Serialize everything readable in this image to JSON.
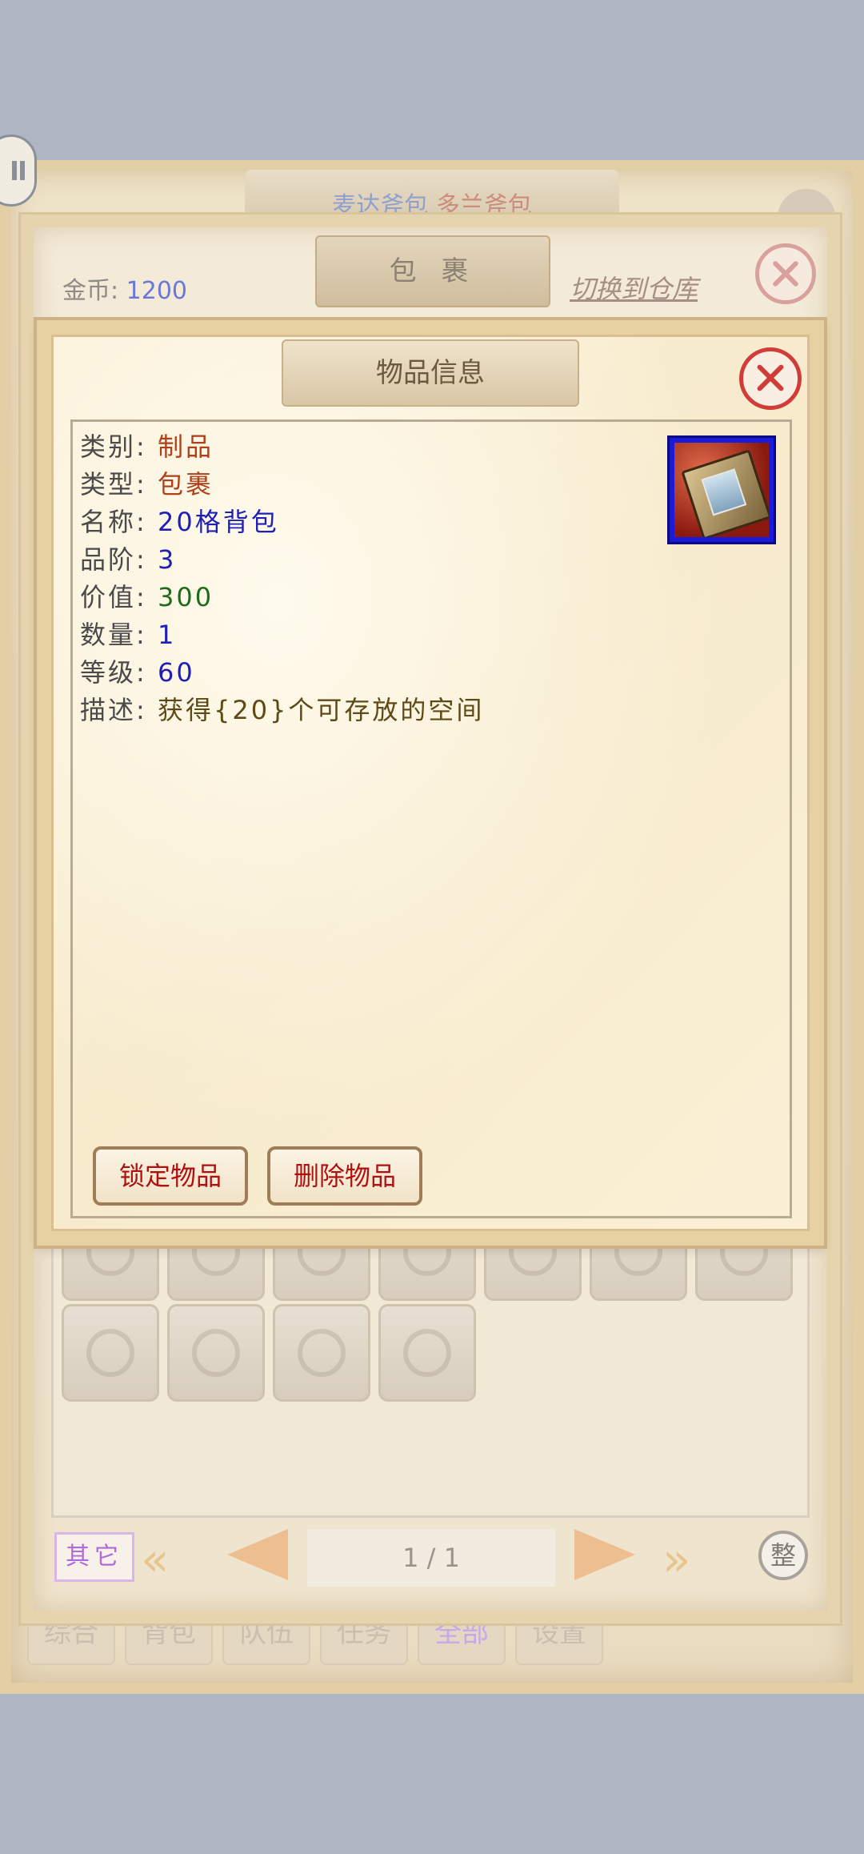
{
  "background_menu": {
    "top_tab_text_a": "麦达斧包",
    "top_tab_text_b": "多兰斧包",
    "bottom_tabs": [
      "综合",
      "背包",
      "队伍",
      "任务",
      "全部",
      "设置"
    ],
    "active_tab": "全部"
  },
  "bag": {
    "title": "包 裹",
    "gold_label": "金币:",
    "gold_value": "1200",
    "switch_link": "切换到仓库",
    "other_button": "其它",
    "page_indicator": "1 / 1",
    "sort_button": "整"
  },
  "item_dialog": {
    "title": "物品信息",
    "rows": [
      {
        "label": "类别:",
        "value": "制品",
        "color": "#b0401a"
      },
      {
        "label": "类型:",
        "value": "包裹",
        "color": "#b0401a"
      },
      {
        "label": "名称:",
        "value": "20格背包",
        "color": "#1f1fb5"
      },
      {
        "label": "品阶:",
        "value": "3",
        "color": "#1f1fb5"
      },
      {
        "label": "价值:",
        "value": "300",
        "color": "#1e6b1a"
      },
      {
        "label": "数量:",
        "value": "1",
        "color": "#1f1fb5"
      },
      {
        "label": "等级:",
        "value": "60",
        "color": "#1f1fb5"
      },
      {
        "label": "描述:",
        "value": "获得{20}个可存放的空间",
        "color": "#5d4a16"
      }
    ],
    "icon": "backpack-book-icon",
    "lock_button": "锁定物品",
    "delete_button": "删除物品"
  }
}
